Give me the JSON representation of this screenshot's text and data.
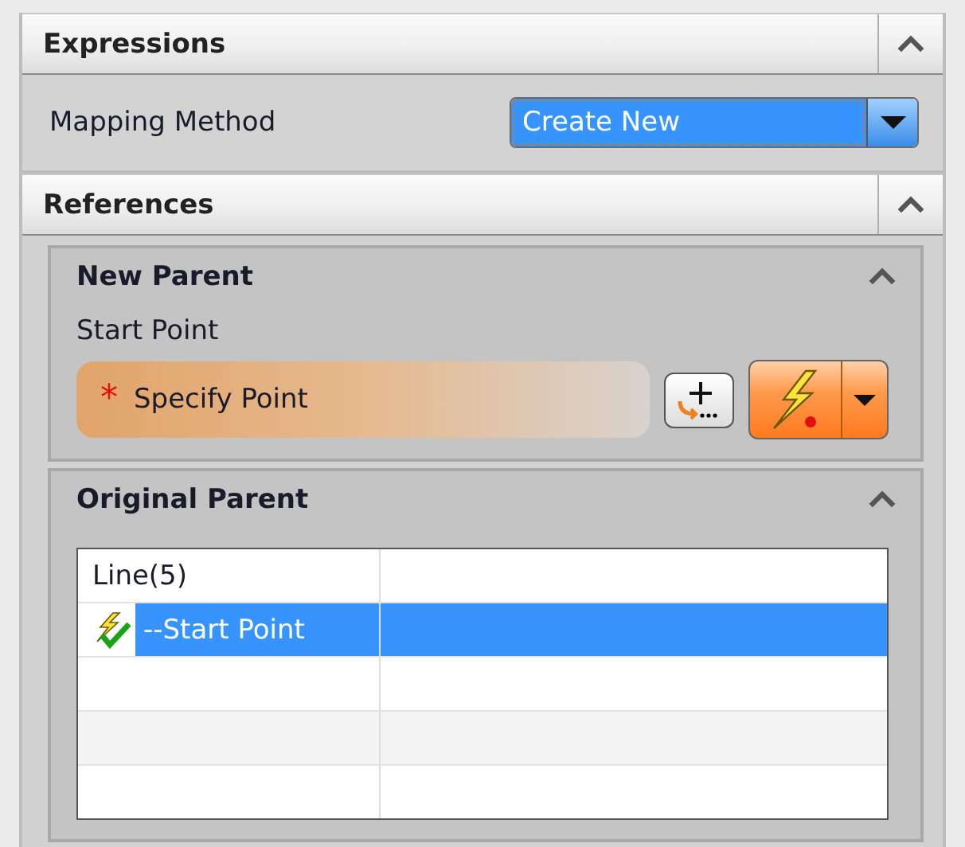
{
  "expressions": {
    "title": "Expressions",
    "expanded": true,
    "mapping_method": {
      "label": "Mapping Method",
      "value": "Create New"
    }
  },
  "references": {
    "title": "References",
    "expanded": true,
    "groups": [
      {
        "kind": "selector",
        "title": "New Parent",
        "expanded": true,
        "field_label": "Start Point",
        "selector": {
          "text": "Specify Point",
          "required_mark": "*"
        }
      },
      {
        "kind": "tree",
        "title": "Original Parent",
        "expanded": true,
        "rows": [
          {
            "label": "Line(5)",
            "selected": false,
            "checked": false
          },
          {
            "label": "--Start Point",
            "selected": true,
            "checked": true
          }
        ]
      }
    ]
  }
}
